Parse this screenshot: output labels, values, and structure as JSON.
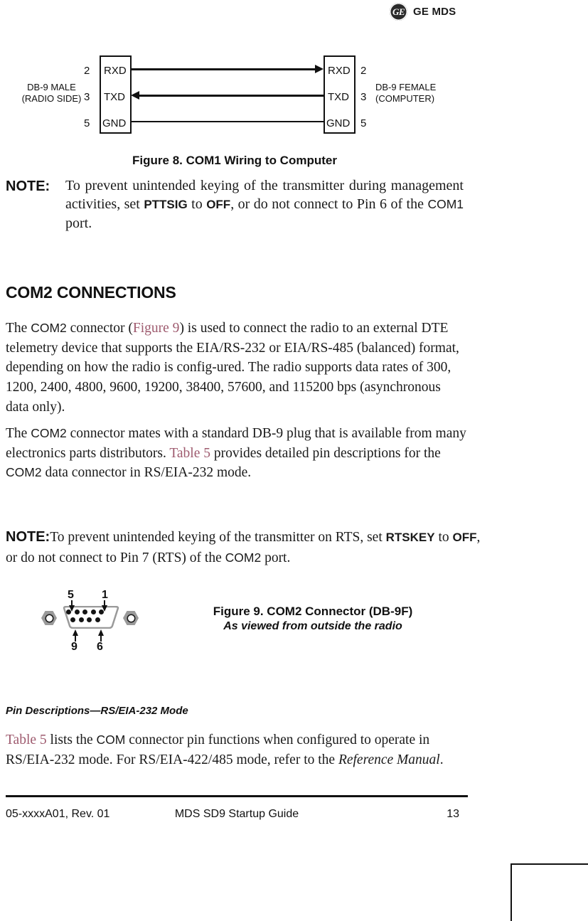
{
  "brand": {
    "monogram": "GE",
    "name": "GE MDS"
  },
  "figure8": {
    "caption": "Figure 8. COM1 Wiring to Computer",
    "left_connector": {
      "title_line1": "DB-9 MALE",
      "title_line2": "(RADIO SIDE)",
      "pins": [
        {
          "number": "2",
          "signal": "RXD"
        },
        {
          "number": "3",
          "signal": "TXD"
        },
        {
          "number": "5",
          "signal": "GND"
        }
      ]
    },
    "right_connector": {
      "title_line1": "DB-9 FEMALE",
      "title_line2": "(COMPUTER)",
      "pins": [
        {
          "number": "2",
          "signal": "RXD"
        },
        {
          "number": "3",
          "signal": "TXD"
        },
        {
          "number": "5",
          "signal": "GND"
        }
      ]
    },
    "wires": [
      {
        "signal": "RXD",
        "direction": "right"
      },
      {
        "signal": "TXD",
        "direction": "left"
      },
      {
        "signal": "GND",
        "direction": "none"
      }
    ]
  },
  "note1": {
    "keyword": "NOTE:",
    "text_part1": "To prevent unintended keying of the transmitter during management activities, set ",
    "term1": "PTTSIG",
    "text_part2": " to ",
    "term2": "OFF",
    "text_part3": ", or do not connect to Pin 6 of the ",
    "term3": "COM1",
    "text_part4": " port."
  },
  "section": {
    "heading": "COM2 CONNECTIONS"
  },
  "paragraph1": {
    "p1": "The ",
    "term1": "COM2",
    "p2": " connector (",
    "link1": "Figure 9",
    "p3": ") is used to connect the radio to an external DTE telemetry device that supports the EIA/RS-232 or EIA/RS-485 (balanced) format, depending on how the radio is config-ured. The radio supports data rates of 300, 1200, 2400, 4800, 9600, 19200, 38400, 57600, and 115200 bps (asynchronous data only)."
  },
  "paragraph2": {
    "p1": "The ",
    "term1": "COM2",
    "p2": " connector mates with a standard DB-9 plug that is available from many electronics parts distributors. ",
    "link1": "Table 5",
    "p3": " provides detailed pin descriptions for the ",
    "term2": "COM2",
    "p4": " data connector in RS/EIA-232 mode."
  },
  "note2": {
    "keyword": "NOTE:",
    "text_part1": "To prevent unintended keying of the transmitter on RTS, set ",
    "term1": "RTSKEY",
    "text_part2": " to ",
    "term2": "OFF",
    "text_part3": ", or do not connect to Pin 7 (RTS) of the ",
    "term3": "COM2",
    "text_part4": " port."
  },
  "figure9": {
    "caption_line1": "Figure 9. COM2 Connector (DB-9F)",
    "caption_line2": "As viewed from outside the radio",
    "pin_labels": {
      "top_left": "5",
      "top_right": "1",
      "bottom_left": "9",
      "bottom_right": "6"
    },
    "top_row_pin_count": 5,
    "bottom_row_pin_count": 4
  },
  "subheading": {
    "text": "Pin Descriptions—RS/EIA-232 Mode"
  },
  "paragraph3": {
    "link1": "Table 5",
    "p1": " lists the ",
    "term1": "COM",
    "p2": " connector pin functions when configured to operate in RS/EIA-232 mode. For RS/EIA-422/485 mode, refer to the ",
    "italic1": "Reference Manual",
    "p3": "."
  },
  "footer": {
    "left": "05-xxxxA01, Rev. 01",
    "center": "MDS SD9 Startup Guide",
    "page": "13"
  },
  "colors": {
    "link": "#9e5a6e",
    "text": "#1a1a1a",
    "rule": "#111111"
  }
}
